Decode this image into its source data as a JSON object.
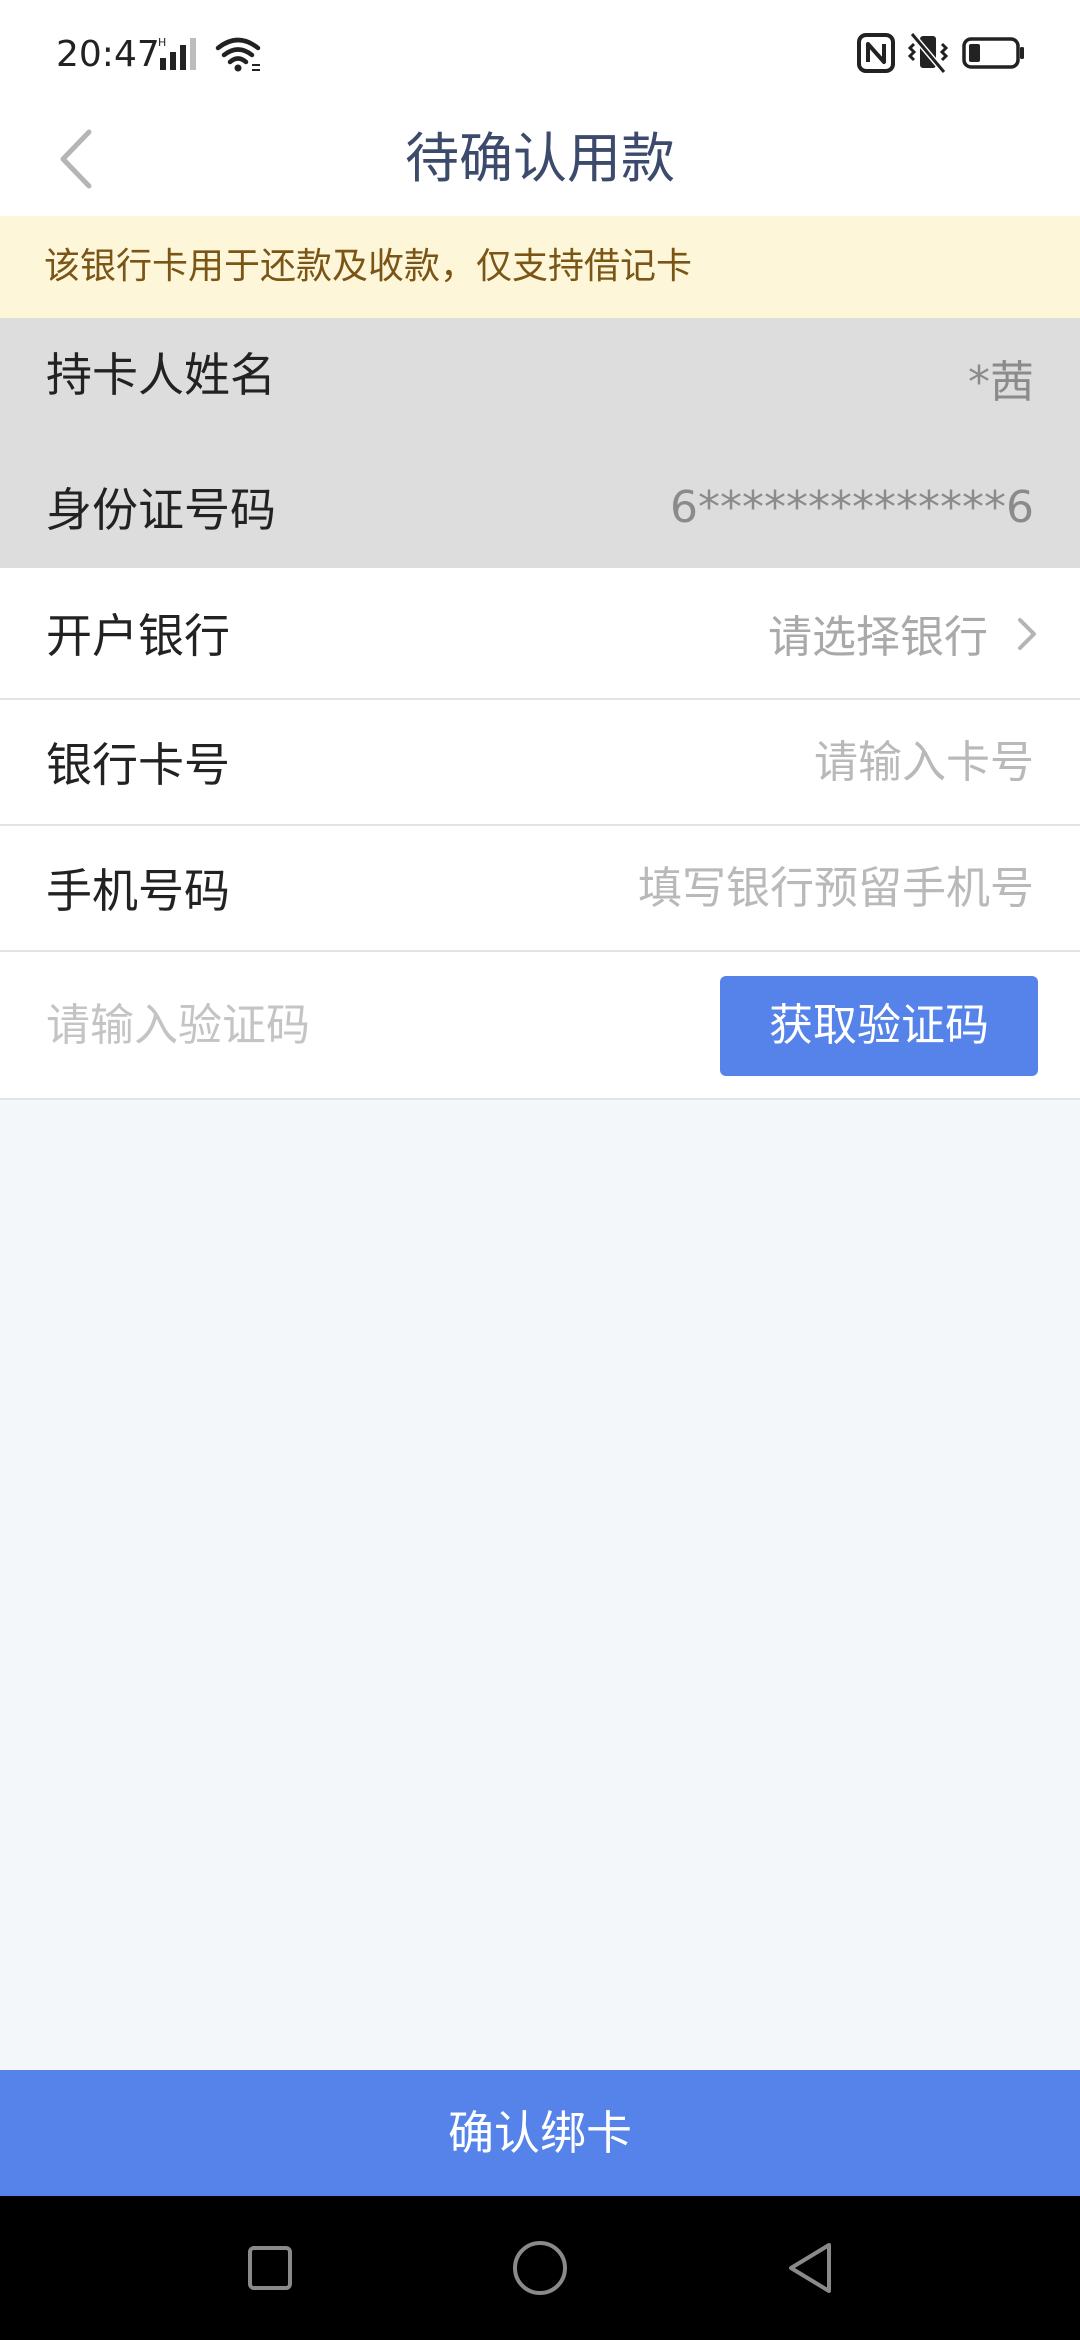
{
  "status_bar": {
    "time": "20:47",
    "icons": [
      "signal-icon",
      "wifi-icon",
      "nfc-icon",
      "vibrate-icon",
      "battery-icon"
    ]
  },
  "header": {
    "title": "待确认用款",
    "back_icon": "chevron-left-icon"
  },
  "notice": {
    "text": "该银行卡用于还款及收款，仅支持借记卡",
    "background": "#fdf6d8",
    "color": "#7a5516"
  },
  "cardholder": {
    "label": "持卡人姓名",
    "value": "*茜"
  },
  "id_number": {
    "label": "身份证号码",
    "value": "6**************6"
  },
  "bank": {
    "label": "开户银行",
    "placeholder": "请选择银行",
    "icon": "chevron-right-icon"
  },
  "card_number": {
    "label": "银行卡号",
    "value": "",
    "placeholder": "请输入卡号"
  },
  "phone": {
    "label": "手机号码",
    "value": "",
    "placeholder": "填写银行预留手机号"
  },
  "verification": {
    "value": "",
    "placeholder": "请输入验证码",
    "button_label": "获取验证码"
  },
  "confirm": {
    "label": "确认绑卡"
  },
  "theme": {
    "accent": "#5683ea",
    "background": "#f4f7fa",
    "title_color": "#3c4a6b"
  },
  "nav_bar": {
    "icons": [
      "square-recents-icon",
      "circle-home-icon",
      "triangle-back-icon"
    ]
  }
}
